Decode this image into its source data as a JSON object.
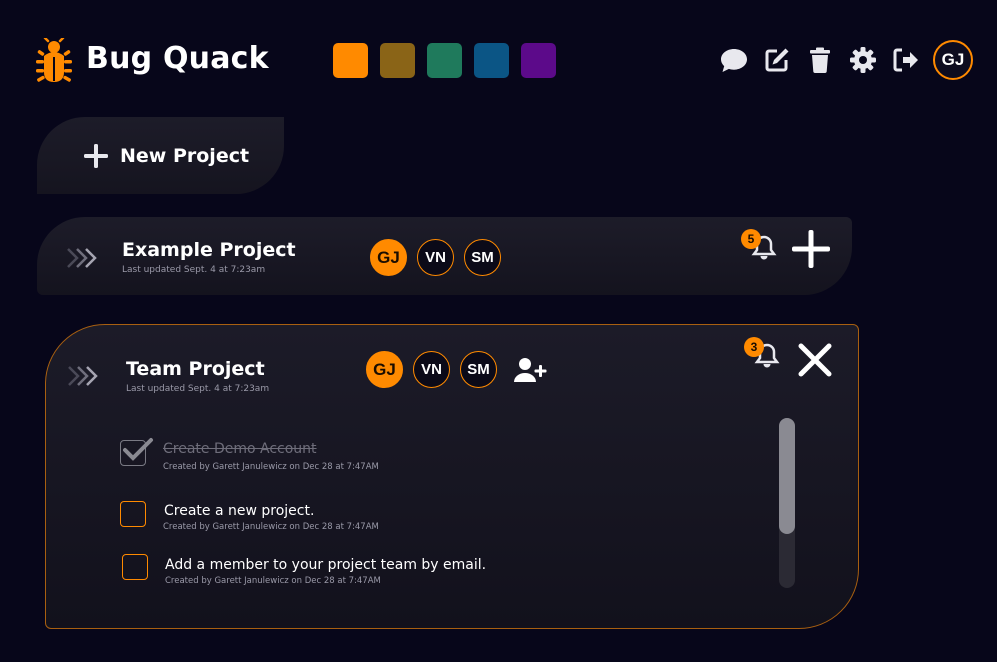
{
  "app": {
    "title": "Bug Quack",
    "logo_icon": "bug-icon"
  },
  "theme_swatches": [
    {
      "name": "orange",
      "color": "#ff8a00"
    },
    {
      "name": "gold",
      "color": "#8a6417"
    },
    {
      "name": "green",
      "color": "#1f7a5c"
    },
    {
      "name": "blue",
      "color": "#0b5585"
    },
    {
      "name": "purple",
      "color": "#5c0a8a"
    }
  ],
  "toolbar": {
    "icons": [
      "chat-icon",
      "edit-icon",
      "trash-icon",
      "gear-icon",
      "logout-icon"
    ],
    "user_initials": "GJ"
  },
  "new_project": {
    "label": "New Project"
  },
  "projects": [
    {
      "title": "Example Project",
      "updated": "Last updated Sept. 4 at 7:23am",
      "members": [
        "GJ",
        "VN",
        "SM"
      ],
      "notifications": "5",
      "expanded": false
    },
    {
      "title": "Team Project",
      "updated": "Last updated Sept. 4 at 7:23am",
      "members": [
        "GJ",
        "VN",
        "SM"
      ],
      "notifications": "3",
      "expanded": true,
      "tasks": [
        {
          "title": "Create Demo Account",
          "meta": "Created by Garett Janulewicz on Dec 28 at 7:47AM",
          "done": true
        },
        {
          "title": "Create a new project.",
          "meta": "Created by Garett Janulewicz on Dec 28 at 7:47AM",
          "done": false
        },
        {
          "title": "Add a member to your project team by email.",
          "meta": "Created by Garett Janulewicz on Dec 28 at 7:47AM",
          "done": false
        }
      ]
    }
  ],
  "colors": {
    "accent": "#ff8a00",
    "background": "#07061a",
    "card": "#1b1a27",
    "muted_text": "#9a99a8"
  }
}
